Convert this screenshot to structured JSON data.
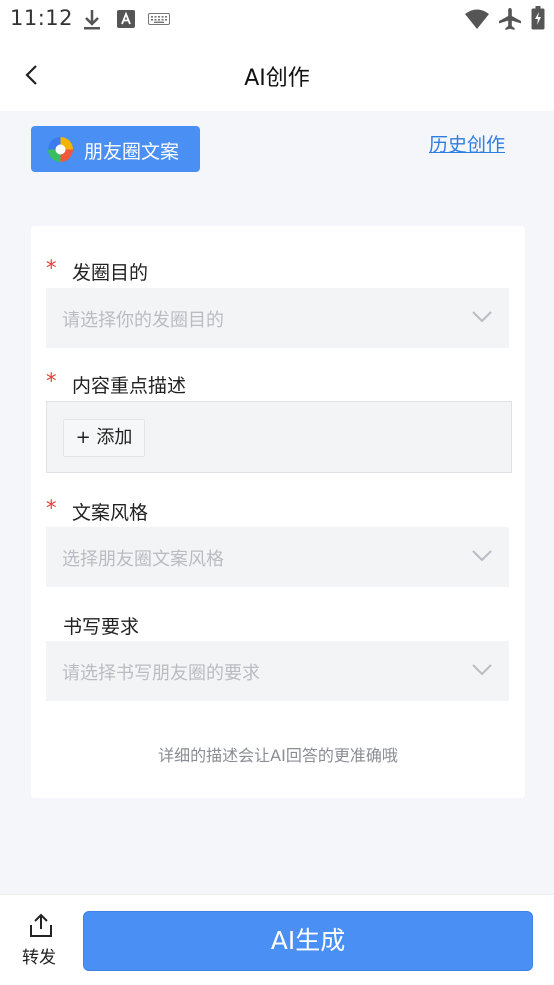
{
  "status_bar": {
    "time": "11:12"
  },
  "header": {
    "title": "AI创作",
    "back_icon": "chevron-left-icon"
  },
  "type_chip": {
    "label": "朋友圈文案"
  },
  "history_link": "历史创作",
  "form": {
    "fields": [
      {
        "label": "发圈目的",
        "required": true,
        "placeholder": "请选择你的发圈目的"
      },
      {
        "label": "内容重点描述",
        "required": true,
        "add_label": "+ 添加"
      },
      {
        "label": "文案风格",
        "required": true,
        "placeholder": "选择朋友圈文案风格"
      },
      {
        "label": "书写要求",
        "required": false,
        "placeholder": "请选择书写朋友圈的要求"
      }
    ],
    "required_mark": "*",
    "hint": "详细的描述会让AI回答的更准确哦"
  },
  "bottom": {
    "share_label": "转发",
    "generate_label": "AI生成"
  },
  "colors": {
    "accent": "#4a8ff3",
    "link": "#2f7de0",
    "required": "#e0403a",
    "page_bg": "#f5f6fa"
  }
}
